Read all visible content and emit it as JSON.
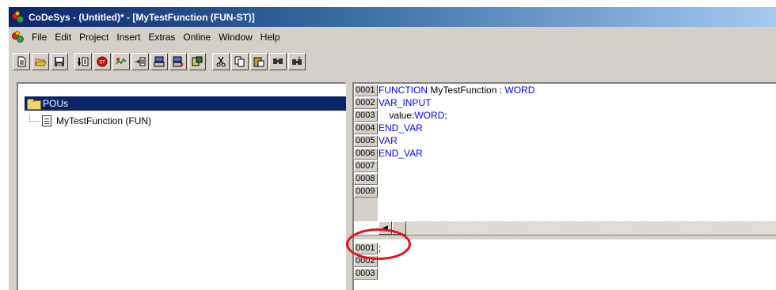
{
  "window": {
    "title": "CoDeSys - (Untitled)* - [MyTestFunction (FUN-ST)]"
  },
  "menu": {
    "items": [
      "File",
      "Edit",
      "Project",
      "Insert",
      "Extras",
      "Online",
      "Window",
      "Help"
    ]
  },
  "toolbar": {
    "buttons": [
      "new-icon",
      "open-icon",
      "save-icon",
      "compile-icon",
      "stop-icon",
      "login-icon",
      "step-icon",
      "login-out-icon",
      "logout-icon",
      "monitor-icon",
      "cut-icon",
      "copy-icon",
      "paste-icon",
      "find-icon",
      "find-next-icon"
    ]
  },
  "tree": {
    "root_label": "POUs",
    "child_label": "MyTestFunction (FUN)"
  },
  "declaration": {
    "lines": [
      {
        "num": "0001",
        "kw1": "FUNCTION",
        "text": " MyTestFunction : ",
        "kw2": "WORD",
        "tail": ""
      },
      {
        "num": "0002",
        "kw1": "VAR_INPUT",
        "text": "",
        "kw2": "",
        "tail": ""
      },
      {
        "num": "0003",
        "kw1": "",
        "text": "    value:",
        "kw2": "WORD",
        "tail": ";"
      },
      {
        "num": "0004",
        "kw1": "END_VAR",
        "text": "",
        "kw2": "",
        "tail": ""
      },
      {
        "num": "0005",
        "kw1": "VAR",
        "text": "",
        "kw2": "",
        "tail": ""
      },
      {
        "num": "0006",
        "kw1": "END_VAR",
        "text": "",
        "kw2": "",
        "tail": ""
      },
      {
        "num": "0007",
        "kw1": "",
        "text": "",
        "kw2": "",
        "tail": ""
      },
      {
        "num": "0008",
        "kw1": "",
        "text": "",
        "kw2": "",
        "tail": ""
      },
      {
        "num": "0009",
        "kw1": "",
        "text": "",
        "kw2": "",
        "tail": ""
      }
    ]
  },
  "body": {
    "lines": [
      {
        "num": "0001",
        "text": ";"
      },
      {
        "num": "0002",
        "text": ""
      },
      {
        "num": "0003",
        "text": ""
      }
    ]
  },
  "colors": {
    "keyword": "#0000ff",
    "annotation": "#e0101a",
    "title_bar": "#0a246a"
  }
}
